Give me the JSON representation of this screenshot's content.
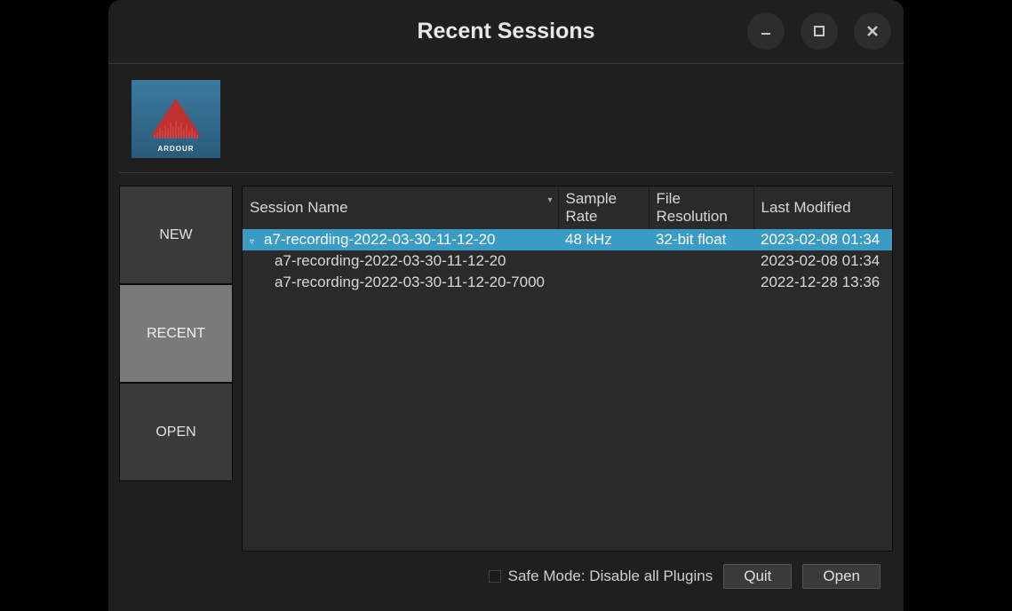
{
  "window": {
    "title": "Recent Sessions"
  },
  "logo": {
    "text": "ARDOUR"
  },
  "sidebar": {
    "new": "NEW",
    "recent": "RECENT",
    "open": "OPEN"
  },
  "table": {
    "headers": {
      "name": "Session Name",
      "rate": "Sample Rate",
      "resolution": "File Resolution",
      "modified": "Last Modified"
    },
    "rows": [
      {
        "name": "a7-recording-2022-03-30-11-12-20",
        "rate": "48 kHz",
        "resolution": "32-bit float",
        "modified": "2023-02-08 01:34"
      },
      {
        "name": "a7-recording-2022-03-30-11-12-20",
        "rate": "",
        "resolution": "",
        "modified": "2023-02-08 01:34"
      },
      {
        "name": "a7-recording-2022-03-30-11-12-20-7000",
        "rate": "",
        "resolution": "",
        "modified": "2022-12-28 13:36"
      }
    ]
  },
  "footer": {
    "safemode": "Safe Mode: Disable all Plugins",
    "quit": "Quit",
    "open": "Open"
  }
}
